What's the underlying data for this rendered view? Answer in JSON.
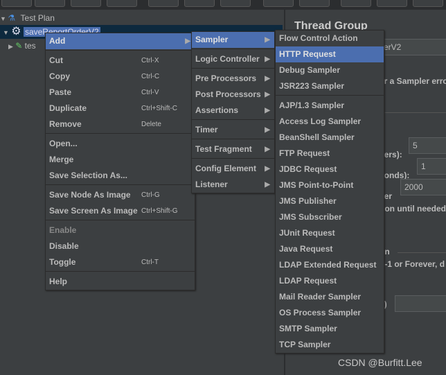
{
  "tree": {
    "items": [
      {
        "label": "Test Plan",
        "icon": "flask-icon"
      },
      {
        "label": "saveReportOrderV2",
        "icon": "gear-icon",
        "selected": true
      },
      {
        "label": "tes",
        "icon": "pipette-icon"
      }
    ]
  },
  "panel": {
    "title": "Thread Group",
    "name_value": "erV2",
    "on_error_text": "er a Sampler erro",
    "users_label": "sers):",
    "users_value": "5",
    "rampup_label": "conds):",
    "rampup_value": "1",
    "loop_label": "ver",
    "loop_value": "2000",
    "delay_text": "tion until needed",
    "section_label": "on",
    "duration_text": ": -1 or Forever, d",
    "lifetime_label": "s)"
  },
  "context_menu": {
    "items": [
      {
        "label": "Add",
        "highlighted": true,
        "submenu": true
      },
      {
        "sep": true
      },
      {
        "label": "Cut",
        "shortcut": "Ctrl-X"
      },
      {
        "label": "Copy",
        "shortcut": "Ctrl-C"
      },
      {
        "label": "Paste",
        "shortcut": "Ctrl-V"
      },
      {
        "label": "Duplicate",
        "shortcut": "Ctrl+Shift-C"
      },
      {
        "label": "Remove",
        "shortcut": "Delete"
      },
      {
        "sep": true
      },
      {
        "label": "Open..."
      },
      {
        "label": "Merge"
      },
      {
        "label": "Save Selection As..."
      },
      {
        "sep": true
      },
      {
        "label": "Save Node As Image",
        "shortcut": "Ctrl-G"
      },
      {
        "label": "Save Screen As Image",
        "shortcut": "Ctrl+Shift-G"
      },
      {
        "sep": true
      },
      {
        "label": "Enable",
        "disabled": true
      },
      {
        "label": "Disable"
      },
      {
        "label": "Toggle",
        "shortcut": "Ctrl-T"
      },
      {
        "sep": true
      },
      {
        "label": "Help"
      }
    ]
  },
  "add_menu": {
    "items": [
      {
        "label": "Sampler",
        "highlighted": true,
        "submenu": true
      },
      {
        "sep": true
      },
      {
        "label": "Logic Controller",
        "submenu": true
      },
      {
        "sep": true
      },
      {
        "label": "Pre Processors",
        "submenu": true
      },
      {
        "label": "Post Processors",
        "submenu": true
      },
      {
        "label": "Assertions",
        "submenu": true
      },
      {
        "sep": true
      },
      {
        "label": "Timer",
        "submenu": true
      },
      {
        "sep": true
      },
      {
        "label": "Test Fragment",
        "submenu": true
      },
      {
        "sep": true
      },
      {
        "label": "Config Element",
        "submenu": true
      },
      {
        "label": "Listener",
        "submenu": true
      }
    ]
  },
  "sampler_menu": {
    "items": [
      {
        "label": "Flow Control Action"
      },
      {
        "label": "HTTP Request",
        "highlighted": true
      },
      {
        "label": "Debug Sampler"
      },
      {
        "label": "JSR223 Sampler"
      },
      {
        "sep": true
      },
      {
        "label": "AJP/1.3 Sampler"
      },
      {
        "label": "Access Log Sampler"
      },
      {
        "label": "BeanShell Sampler"
      },
      {
        "label": "FTP Request"
      },
      {
        "label": "JDBC Request"
      },
      {
        "label": "JMS Point-to-Point"
      },
      {
        "label": "JMS Publisher"
      },
      {
        "label": "JMS Subscriber"
      },
      {
        "label": "JUnit Request"
      },
      {
        "label": "Java Request"
      },
      {
        "label": "LDAP Extended Request"
      },
      {
        "label": "LDAP Request"
      },
      {
        "label": "Mail Reader Sampler"
      },
      {
        "label": "OS Process Sampler"
      },
      {
        "label": "SMTP Sampler"
      },
      {
        "label": "TCP Sampler"
      }
    ]
  },
  "watermark": "CSDN @Burfitt.Lee",
  "colors": {
    "highlight": "#4b6eaf",
    "background": "#3c3f41"
  }
}
